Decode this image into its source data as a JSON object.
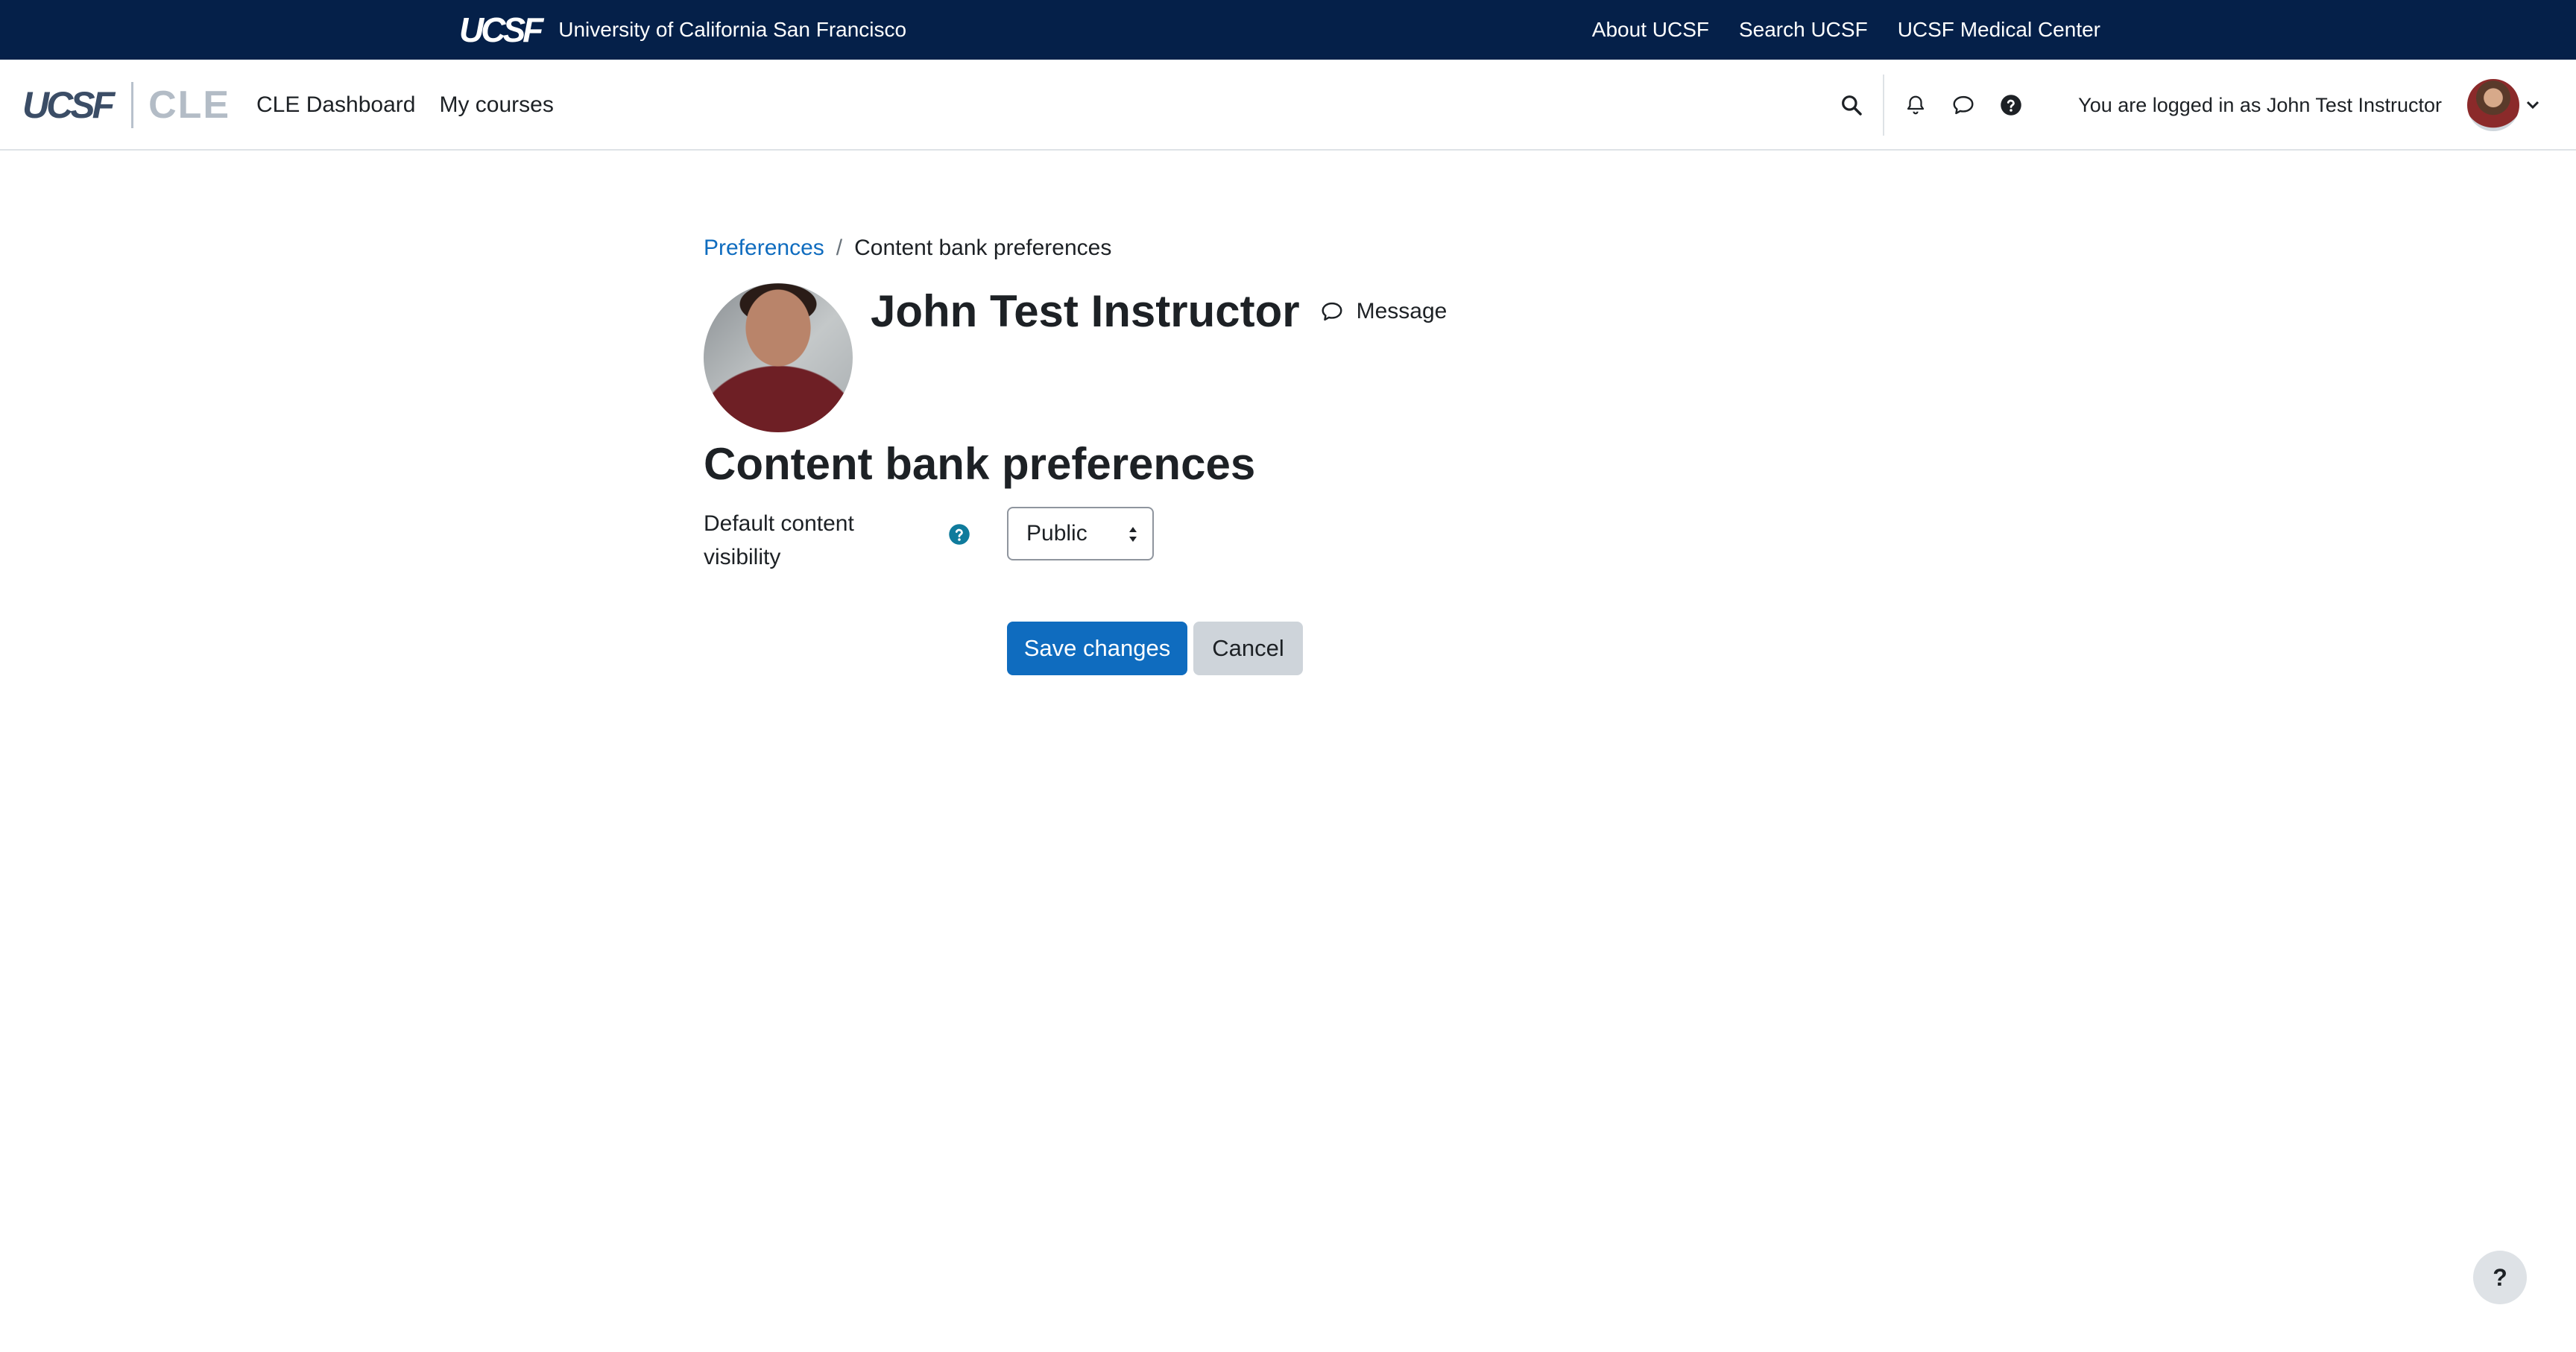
{
  "ucsf_bar": {
    "wordmark": "UCSF",
    "brand_name": "University of California San Francisco",
    "links": [
      "About UCSF",
      "Search UCSF",
      "UCSF Medical Center"
    ]
  },
  "navbar": {
    "logo_ucsf": "UCSF",
    "logo_cle": "CLE",
    "primary_nav": [
      "CLE Dashboard",
      "My courses"
    ],
    "login_info": "You are logged in as John Test Instructor",
    "icons": [
      "search-icon",
      "bell-icon",
      "chat-icon",
      "help-icon"
    ]
  },
  "breadcrumb": {
    "parent": "Preferences",
    "separator": "/",
    "current": "Content bank preferences"
  },
  "profile": {
    "name": "John Test Instructor",
    "message_label": "Message"
  },
  "page": {
    "heading": "Content bank preferences"
  },
  "form": {
    "visibility_label": "Default content visibility",
    "visibility_value": "Public",
    "save_label": "Save changes",
    "cancel_label": "Cancel"
  },
  "floating_help": {
    "label": "?"
  },
  "colors": {
    "ucsf_navy": "#052049",
    "link_blue": "#0f6cbf",
    "help_teal": "#0f7b9c",
    "secondary_btn": "#ced4da"
  }
}
